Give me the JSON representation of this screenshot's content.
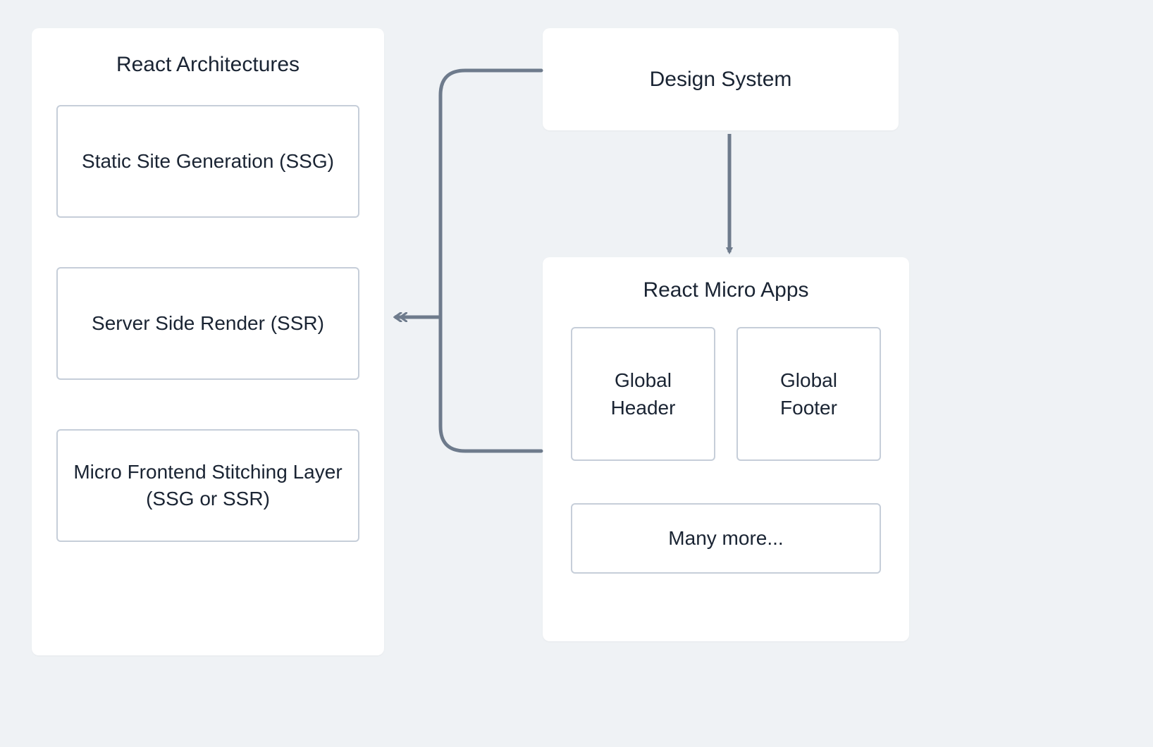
{
  "colors": {
    "bg": "#eff2f5",
    "panel": "#ffffff",
    "border": "#c6ced9",
    "text": "#1a2433",
    "connector": "#6e7b8c"
  },
  "left_panel": {
    "title": "React Architectures",
    "items": [
      "Static Site Generation (SSG)",
      "Server Side Render  (SSR)",
      "Micro Frontend Stitching Layer (SSG or SSR)"
    ]
  },
  "design_system": {
    "title": "Design System"
  },
  "micro_apps": {
    "title": "React Micro Apps",
    "items_row": [
      "Global Header",
      "Global Footer"
    ],
    "more": "Many more..."
  },
  "connectors": {
    "design_to_micro": {
      "from": "design-system-panel",
      "to": "micro-apps-panel",
      "style": "arrow-single"
    },
    "micro_to_arch": {
      "from": "micro-apps-panel",
      "to": "react-arch-panel",
      "style": "bracket-arrow-double"
    }
  }
}
